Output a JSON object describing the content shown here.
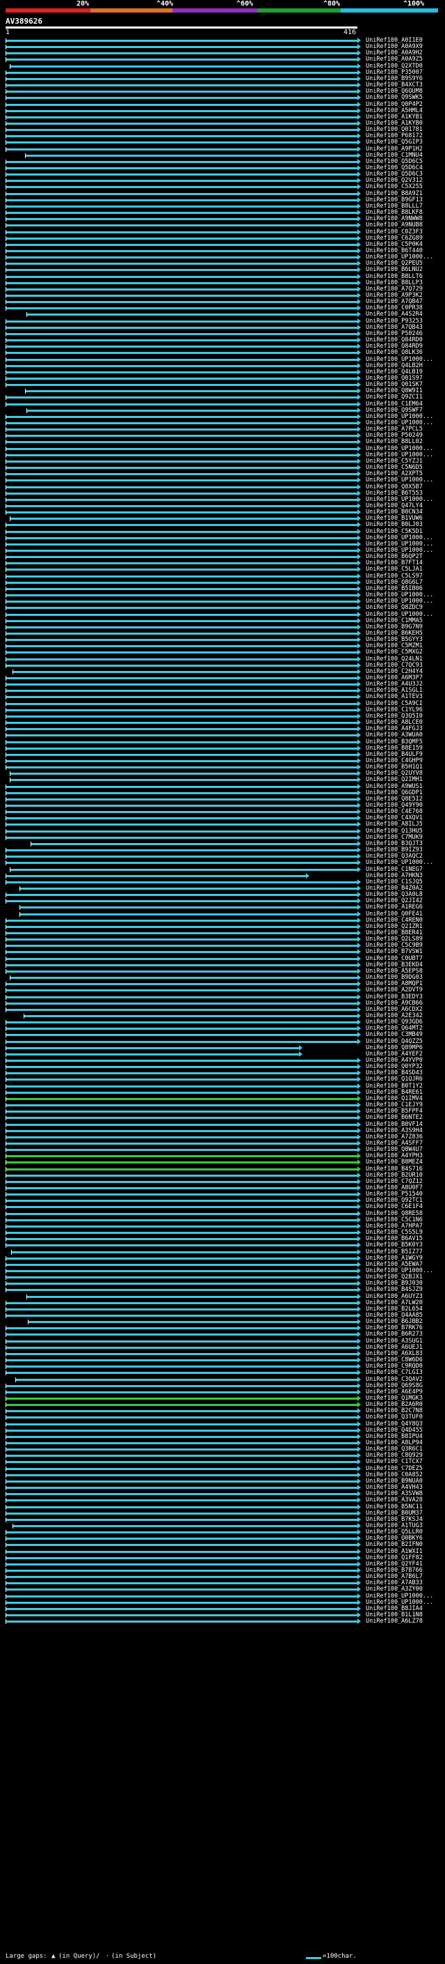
{
  "scale": {
    "labels": [
      "20%",
      "^40%",
      "^60%",
      "^80%",
      "^100%"
    ],
    "colors": [
      "#e02020",
      "#e07020",
      "#9030c0",
      "#20a030",
      "#20c0e0"
    ]
  },
  "query": {
    "name": "AV389626",
    "start": "1",
    "end": "416"
  },
  "hit_colors": {
    "normal": "#40c8e0",
    "alt": "#3cc840"
  },
  "hits": [
    "UniRef100_A0I1E0",
    "UniRef100_A0A9X9",
    "UniRef100_A0A9H2",
    "UniRef100_A0A9Z5",
    "UniRef100_Q2XTD0",
    "UniRef100_P35007",
    "UniRef100_B9S9Y6",
    "UniRef100_B4XCT3",
    "UniRef100_Q6QUM8",
    "UniRef100_Q9SWK5",
    "UniRef100_Q0P4P2",
    "UniRef100_A5HML4",
    "UniRef100_A1KYB1",
    "UniRef100_A1KYB0",
    "UniRef100_Q01781",
    "UniRef100_P68172",
    "UniRef100_Q5GIP3",
    "UniRef100_A9P1H2",
    "UniRef100_C1MNU4",
    "UniRef100_Q5D6C5",
    "UniRef100_Q5D6C4",
    "UniRef100_Q5D6C3",
    "UniRef100_Q2V312",
    "UniRef100_C5X255",
    "UniRef100_B8A9Z1",
    "UniRef100_B9GF13",
    "UniRef100_B8LLL7",
    "UniRef100_B8LKF8",
    "UniRef100_A9NWW8",
    "UniRef100_A9NUB8",
    "UniRef100_C0Z3F3",
    "UniRef100_C6ZG89",
    "UniRef100_C5P0K4",
    "UniRef100_B6T440",
    "UniRef100_UP1000...",
    "UniRef100_Q2PEU5",
    "UniRef100_B6LNU2",
    "UniRef100_B8LLT6",
    "UniRef100_B8LLP3",
    "UniRef100_A7Q729",
    "UniRef100_A9P3K2",
    "UniRef100_A7QB47",
    "UniRef100_C0PR38",
    "UniRef100_A4S2R4",
    "UniRef100_P93253",
    "UniRef100_A7QB43",
    "UniRef100_P50246",
    "UniRef100_Q84RD0",
    "UniRef100_Q84RD9",
    "UniRef100_Q8LK36",
    "UniRef100_UP1000...",
    "UniRef100_Q4LB2H",
    "UniRef100_Q4LB19",
    "UniRef100_Q01S97",
    "UniRef100_Q01SK7",
    "UniRef100_Q8W9I1",
    "UniRef100_Q9ZCI1",
    "UniRef100_C1EM64",
    "UniRef100_Q9SWF7",
    "UniRef100_UP1000...",
    "UniRef100_UP1000...",
    "UniRef100_A7PCL5",
    "UniRef100_P50249",
    "UniRef100_B8LL02",
    "UniRef100_UP1000...",
    "UniRef100_UP1000...",
    "UniRef100_C5YZJ1",
    "UniRef100_C5N6D5",
    "UniRef100_A2XPT5",
    "UniRef100_UP1000...",
    "UniRef100_Q8X5B7",
    "UniRef100_B6T553",
    "UniRef100_UP1000...",
    "UniRef100_Q47LY4",
    "UniRef100_B0CN34",
    "UniRef100_B1VUW6",
    "UniRef100_B0LJ03",
    "UniRef100_C5K5D1",
    "UniRef100_UP1000...",
    "UniRef100_UP1000...",
    "UniRef100_UP1000...",
    "UniRef100_B6QP2T",
    "UniRef100_B7FT14",
    "UniRef100_C5LJA1",
    "UniRef100_C5LS97",
    "UniRef100_Q8G6L7",
    "UniRef100_B5IB06",
    "UniRef100_UP1000...",
    "UniRef100_UP1000...",
    "UniRef100_Q8ZDC9",
    "UniRef100_UP1000...",
    "UniRef100_C1MMA5",
    "UniRef100_B9G7N9",
    "UniRef100_B6KEH5",
    "UniRef100_B5GYY3",
    "UniRef100_C5MZM1",
    "UniRef100_C5MXG2",
    "UniRef100_Q24LN1",
    "UniRef100_C7QC93",
    "UniRef100_C2H4Y4",
    "UniRef100_A6M3P7",
    "UniRef100_A4U3J2",
    "UniRef100_A1SGL1",
    "UniRef100_A1TEV3",
    "UniRef100_C5A9CI",
    "UniRef100_C1YL96",
    "UniRef100_Q3Q5I0",
    "UniRef100_A8LCE0",
    "UniRef100_A4FGJ3",
    "UniRef100_A3WUA0",
    "UniRef100_B3QMF5",
    "UniRef100_B8E159",
    "UniRef100_B4ULF9",
    "UniRef100_C4GHP9",
    "UniRef100_B5H1Q1",
    "UniRef100_Q2UYV8",
    "UniRef100_Q2IMH1",
    "UniRef100_A9WUS1",
    "UniRef100_Q6GDP1",
    "UniRef100_Q8E5I2",
    "UniRef100_Q49Y90",
    "UniRef100_C4E768",
    "UniRef100_C4XQV1",
    "UniRef100_A8ILJ5",
    "UniRef100_Q13HU5",
    "UniRef100_C7MUK9",
    "UniRef100_B3QJT3",
    "UniRef100_B9IZ93",
    "UniRef100_Q3AQC2",
    "UniRef100_UP1000...",
    "UniRef100_C1NEG7",
    "UniRef100_A7HKN3",
    "UniRef100_C1SJQ5",
    "UniRef100_B4Z0A2",
    "UniRef100_Q3A0L8",
    "UniRef100_Q2JI42",
    "UniRef100_A1REG6",
    "UniRef100_Q0FE41",
    "UniRef100_C4REN0",
    "UniRef100_Q21ZR1",
    "UniRef100_B8ER41",
    "UniRef100_Q2LS89",
    "UniRef100_C5C9B9",
    "UniRef100_B7VSW1",
    "UniRef100_C0UBT7",
    "UniRef100_B3EKD4",
    "UniRef100_A5EPS8",
    "UniRef100_B9DG03",
    "UniRef100_A8MQP1",
    "UniRef100_A2DVT9",
    "UniRef100_B3EDY3",
    "UniRef100_A9CB66",
    "UniRef100_A6CDX2",
    "UniRef100_A2E342",
    "UniRef100_Q93GD6",
    "UniRef100_Q64MT2",
    "UniRef100_C3MB49",
    "UniRef100_Q4QZZ5",
    "UniRef100_Q89MP6",
    "UniRef100_A4YEF2",
    "UniRef100_A4YVP0",
    "UniRef100_Q0YP32",
    "UniRef100_B4SD43",
    "UniRef100_Q1QJR6",
    "UniRef100_B0T1Y2",
    "UniRef100_B4RE61",
    "UniRef100_Q1IMV4",
    "UniRef100_C1EJY9",
    "UniRef100_B5FPF4",
    "UniRef100_B6NTE2",
    "UniRef100_B0VF14",
    "UniRef100_A3S9H4",
    "UniRef100_A7Z836",
    "UniRef100_A4SFF7",
    "UniRef100_Q8W4U7",
    "UniRef100_A4YPH3",
    "UniRef100_B8MEZ4",
    "UniRef100_B4S716",
    "UniRef100_B2UR10",
    "UniRef100_C7QZ12",
    "UniRef100_A8U0F7",
    "UniRef100_P51540",
    "UniRef100_Q92TC1",
    "UniRef100_C6E1F4",
    "UniRef100_Q8RE58",
    "UniRef100_C5C1N6",
    "UniRef100_A7HPA7",
    "UniRef100_C5S5L9",
    "UniRef100_B6AV15",
    "UniRef100_B5K0Y3",
    "UniRef100_B5IZ77",
    "UniRef100_A1WGY9",
    "UniRef100_A5EWA7",
    "UniRef100_UP1000...",
    "UniRef100_Q2BJX1",
    "UniRef100_B9J030",
    "UniRef100_B4SJZ9",
    "UniRef100_A6UYZ3",
    "UniRef100_A7LW20",
    "UniRef100_B2L654",
    "UniRef100_Q4AA85",
    "UniRef100_B6JBB2",
    "UniRef100_B7RK76",
    "UniRef100_B6R273",
    "UniRef100_A3SUG1",
    "UniRef100_A6UEJ1",
    "UniRef100_A6XL83",
    "UniRef100_C8W6D6",
    "UniRef100_C9RQD0",
    "UniRef100_C7LGI3",
    "UniRef100_C3QAV2",
    "UniRef100_Q69S8G",
    "UniRef100_A6E4P9",
    "UniRef100_Q1MGK3",
    "UniRef100_B2A6R0",
    "UniRef100_B2C7N8",
    "UniRef100_Q3TUF0",
    "UniRef100_Q4Y8Q3",
    "UniRef100_Q4D455",
    "UniRef100_B8IPU4",
    "UniRef100_A8LP94",
    "UniRef100_Q3R6C1",
    "UniRef100_C8Q929",
    "UniRef100_C1TCX7",
    "UniRef100_C7DEZ5",
    "UniRef100_C0A852",
    "UniRef100_B9NUA0",
    "UniRef100_A4VH43",
    "UniRef100_A3SVW8",
    "UniRef100_A3VA28",
    "UniRef100_B5NC11",
    "UniRef100_B0UM37",
    "UniRef100_B7KSJ4",
    "UniRef100_A1TUG3",
    "UniRef100_Q5LLR0",
    "UniRef100_Q0BKY6",
    "UniRef100_B2IFN0",
    "UniRef100_A1WXI1",
    "UniRef100_Q1FF82",
    "UniRef100_Q2YF41",
    "UniRef100_B7B766",
    "UniRef100_A7B6L7",
    "UniRef100_A7AB33",
    "UniRef100_A3ZY00",
    "UniRef100_UP1000...",
    "UniRef100_UP1000...",
    "UniRef100_B8JIA4",
    "UniRef100_B1L1N8",
    "UniRef100_A6LZ78"
  ],
  "legend": {
    "prefix": "Large gaps:",
    "in_query": "(in Query)/",
    "in_subject": "(in Subject)",
    "scale_text": "=100char."
  }
}
